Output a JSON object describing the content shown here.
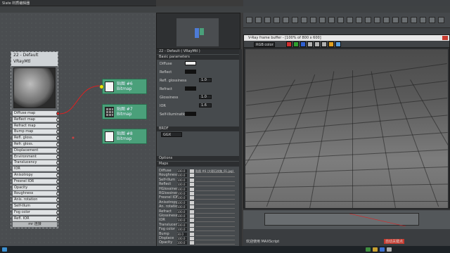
{
  "slate": {
    "title": "Slate 材质编辑器",
    "material_node": {
      "title": "22 - Default",
      "type": "VRayMtl",
      "slots": [
        "Diffuse map",
        "Reflect map",
        "Refract map",
        "Bump map",
        "Refl. gloss.",
        "Refr. gloss.",
        "Displacement",
        "Environment",
        "Translucency",
        "IOR",
        "Anisotropy",
        "Fresnel IOR",
        "Opacity",
        "Roughness",
        "Anis. rotation",
        "Self-illum",
        "Fog color",
        "Refl. IOR"
      ],
      "footer": "mr 连接"
    },
    "bitmap_nodes": [
      {
        "name": "贴图 #6",
        "type": "Bitmap"
      },
      {
        "name": "贴图 #7",
        "type": "Bitmap"
      },
      {
        "name": "贴图 #8",
        "type": "Bitmap"
      }
    ]
  },
  "params": {
    "header": "22 - Default ( VRayMtl )",
    "rollout_basic": "Basic parameters",
    "rows": [
      {
        "label": "Diffuse",
        "value": ""
      },
      {
        "label": "Reflect",
        "value": ""
      },
      {
        "label": "Refl. glossiness",
        "value": "1.0"
      },
      {
        "label": "Refract",
        "value": ""
      },
      {
        "label": "Glossiness",
        "value": "1.0"
      },
      {
        "label": "IOR",
        "value": "1.6"
      },
      {
        "label": "Self-illumination",
        "value": ""
      }
    ],
    "rollout_brdf": "BRDF",
    "brdf_type": "GGX",
    "rollout_options": "Options",
    "rollout_maps": "Maps",
    "maps": [
      {
        "label": "Diffuse",
        "amount": "100.0"
      },
      {
        "label": "Roughness",
        "amount": "100.0"
      },
      {
        "label": "Self-illum",
        "amount": "100.0"
      },
      {
        "label": "Reflect",
        "amount": "100.0"
      },
      {
        "label": "HGlossiness",
        "amount": "100.0"
      },
      {
        "label": "RGlossiness",
        "amount": "100.0"
      },
      {
        "label": "Fresnel IOR",
        "amount": "100.0"
      },
      {
        "label": "Anisotropy",
        "amount": "100.0"
      },
      {
        "label": "An. rotation",
        "amount": "100.0"
      },
      {
        "label": "Refract",
        "amount": "100.0"
      },
      {
        "label": "Glossiness",
        "amount": "100.0"
      },
      {
        "label": "IOR",
        "amount": "100.0"
      },
      {
        "label": "Translucent",
        "amount": "100.0"
      },
      {
        "label": "Fog color",
        "amount": "100.0"
      },
      {
        "label": "Bump",
        "amount": "30.0"
      },
      {
        "label": "Displace",
        "amount": "100.0"
      },
      {
        "label": "Opacity",
        "amount": "100.0"
      }
    ],
    "map_first_name": "贴图 #6 (大理石纹路_01.jpg)"
  },
  "max": {
    "vfb_title": "V-Ray frame buffer - [100% of 800 x 600]",
    "vfb_channel": "RGB color",
    "status_left": "欢迎使用 MAXScript",
    "status_right": "自动关键点"
  },
  "colors": {
    "bitmap_node": "#4aa07a",
    "wire": "#e02020",
    "close": "#c83a2e"
  }
}
